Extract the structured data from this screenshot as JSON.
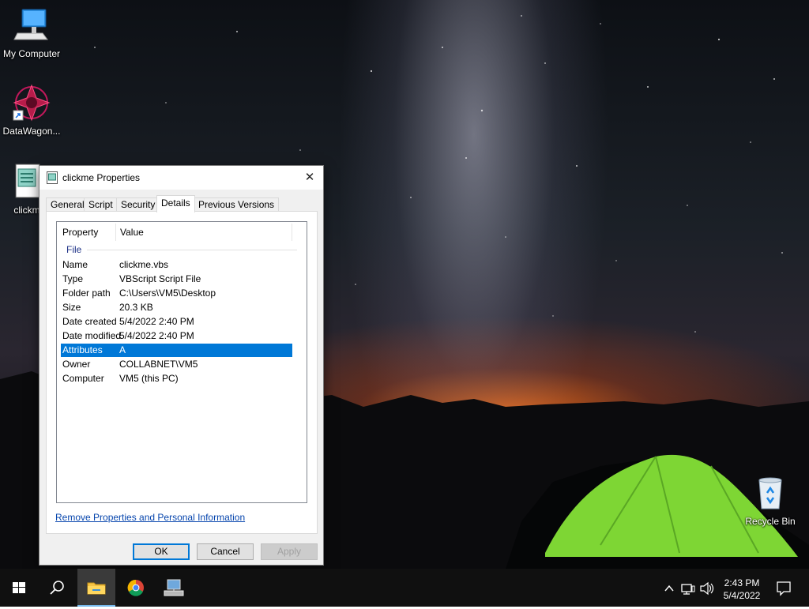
{
  "desktop": {
    "icons": [
      {
        "label": "My Computer",
        "icon": "computer-icon"
      },
      {
        "label": "DataWagon...",
        "icon": "datawagon-shortcut-icon"
      },
      {
        "label": "clickm",
        "icon": "vbscript-file-icon"
      },
      {
        "label": "Recycle Bin",
        "icon": "recycle-bin-icon"
      }
    ]
  },
  "dialog": {
    "title": "clickme Properties",
    "close_glyph": "✕",
    "tabs": [
      "General",
      "Script",
      "Security",
      "Details",
      "Previous Versions"
    ],
    "active_tab": "Details",
    "columns": {
      "property": "Property",
      "value": "Value"
    },
    "group": "File",
    "rows": [
      {
        "key": "Name",
        "value": "clickme.vbs"
      },
      {
        "key": "Type",
        "value": "VBScript Script File"
      },
      {
        "key": "Folder path",
        "value": "C:\\Users\\VM5\\Desktop"
      },
      {
        "key": "Size",
        "value": "20.3 KB"
      },
      {
        "key": "Date created",
        "value": "5/4/2022 2:40 PM"
      },
      {
        "key": "Date modified",
        "value": "5/4/2022 2:40 PM"
      },
      {
        "key": "Attributes",
        "value": "A"
      },
      {
        "key": "Owner",
        "value": "COLLABNET\\VM5"
      },
      {
        "key": "Computer",
        "value": "VM5 (this PC)"
      }
    ],
    "selected_row": "Attributes",
    "remove_link": "Remove Properties and Personal Information",
    "buttons": {
      "ok": "OK",
      "cancel": "Cancel",
      "apply": "Apply"
    }
  },
  "taskbar": {
    "items": [
      "start-icon",
      "search-icon",
      "file-explorer-icon",
      "chrome-icon",
      "network-app-icon"
    ],
    "active_item": "file-explorer-icon",
    "tray_icons": [
      "chevron-up-icon",
      "network-icon",
      "volume-icon"
    ],
    "time": "2:43 PM",
    "date": "5/4/2022"
  },
  "colors": {
    "selection": "#0078d7",
    "link": "#0645ad",
    "taskbar": "#101010",
    "tent_green": "#8ee63a"
  }
}
